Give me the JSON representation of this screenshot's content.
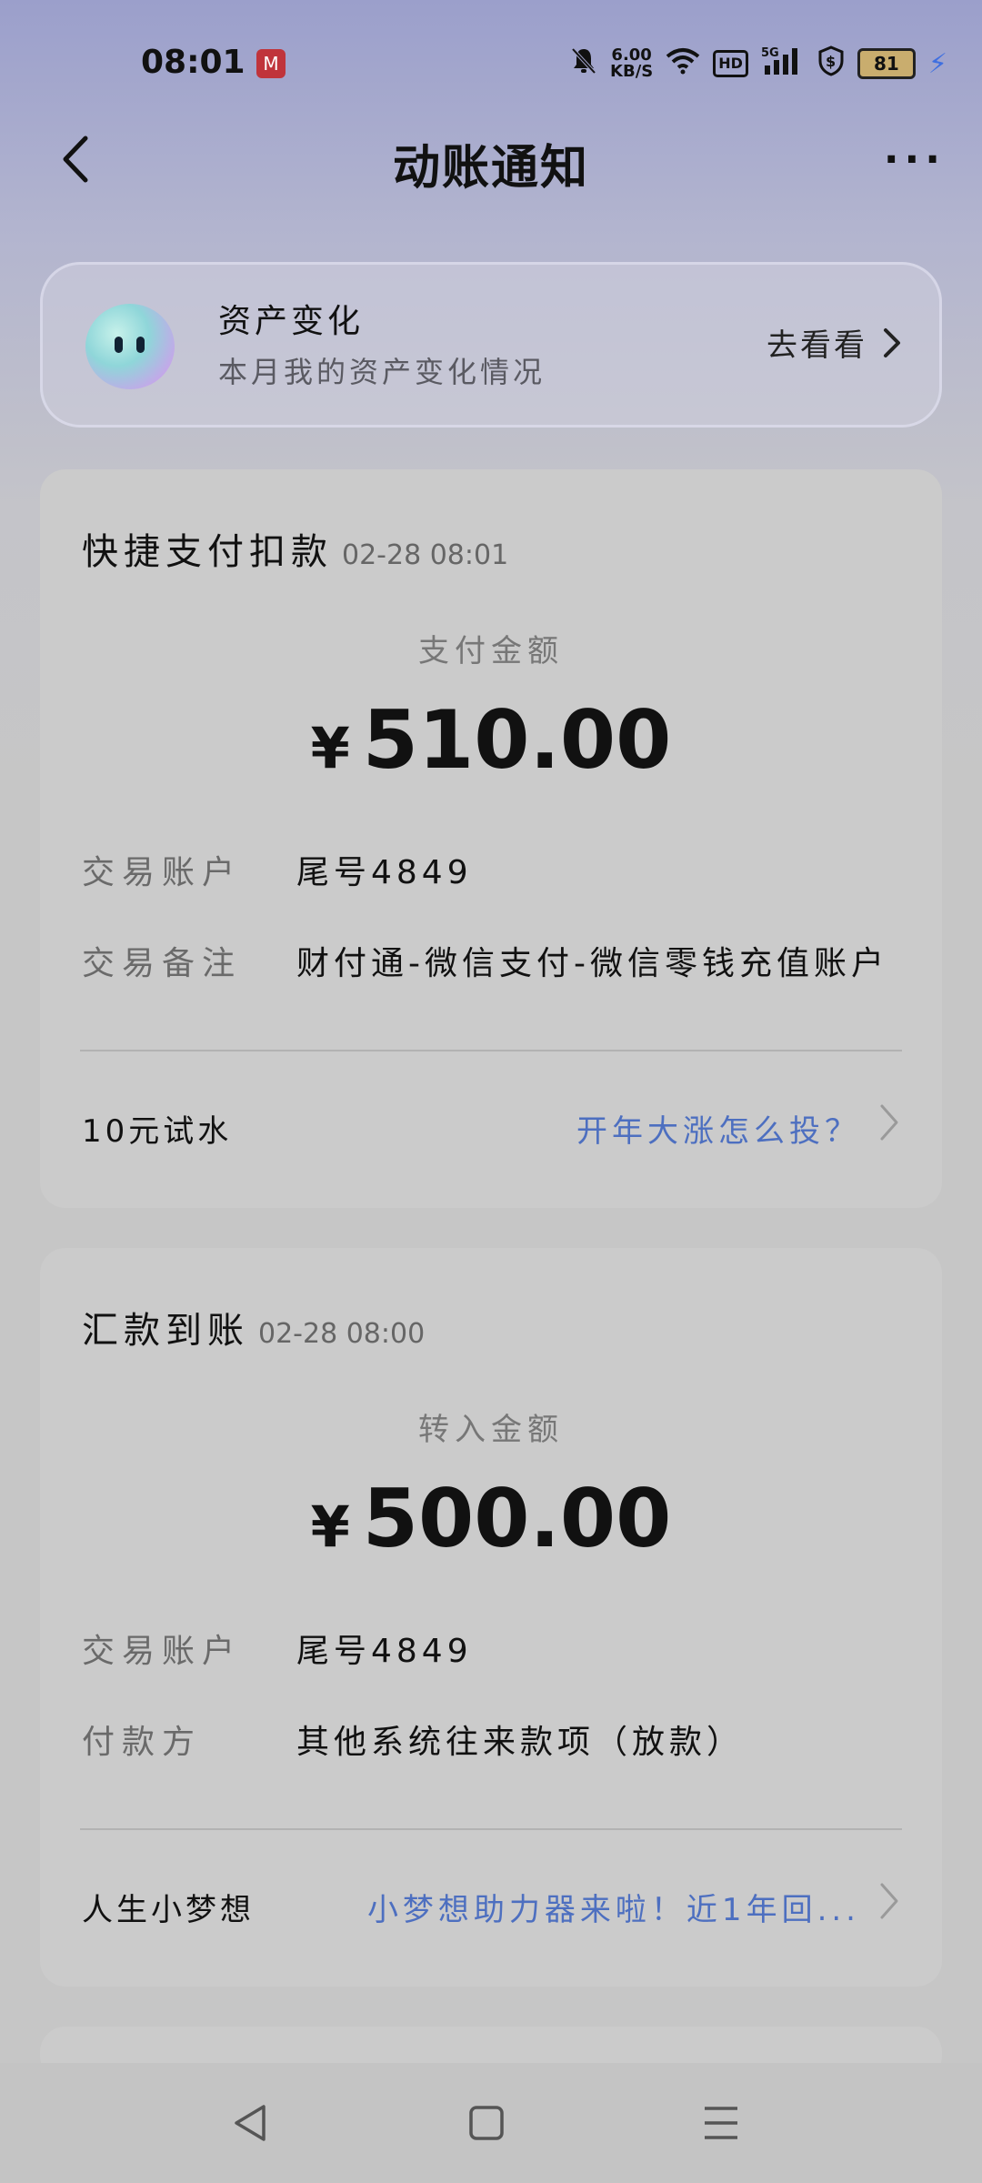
{
  "status_bar": {
    "time": "08:01",
    "app_badge": "M",
    "net_speed_value": "6.00",
    "net_speed_unit": "KB/S",
    "hd": "HD",
    "signal": "5G",
    "battery": "81",
    "icons": [
      "mute-bell-icon",
      "wifi-icon",
      "hd-icon",
      "5g-signal-icon",
      "shield-dollar-icon",
      "battery-icon",
      "charging-bolt-icon"
    ]
  },
  "header": {
    "title": "动账通知",
    "back_icon": "back-chevron-icon",
    "more_icon": "more-dots-icon"
  },
  "asset_banner": {
    "title": "资产变化",
    "subtitle": "本月我的资产变化情况",
    "action": "去看看"
  },
  "cards": [
    {
      "type": "快捷支付扣款",
      "time": "02-28 08:01",
      "amount_label": "支付金额",
      "currency": "¥",
      "amount": "510.00",
      "rows": [
        {
          "label": "交易账户",
          "value": "尾号4849"
        },
        {
          "label": "交易备注",
          "value": "财付通-微信支付-微信零钱充值账户"
        }
      ],
      "footer_left": "10元试水",
      "footer_link": "开年大涨怎么投？"
    },
    {
      "type": "汇款到账",
      "time": "02-28 08:00",
      "amount_label": "转入金额",
      "currency": "¥",
      "amount": "500.00",
      "rows": [
        {
          "label": "交易账户",
          "value": "尾号4849"
        },
        {
          "label": "付款方",
          "value": "其他系统往来款项（放款）"
        }
      ],
      "footer_left": "人生小梦想",
      "footer_link": "小梦想助力器来啦！近1年回..."
    }
  ],
  "nav": {
    "buttons": [
      "nav-back-icon",
      "nav-home-icon",
      "nav-menu-icon"
    ]
  },
  "colors": {
    "link": "#4d6fc0",
    "card_bg": "#cbcbcb",
    "charging": "#3f6fe0"
  }
}
